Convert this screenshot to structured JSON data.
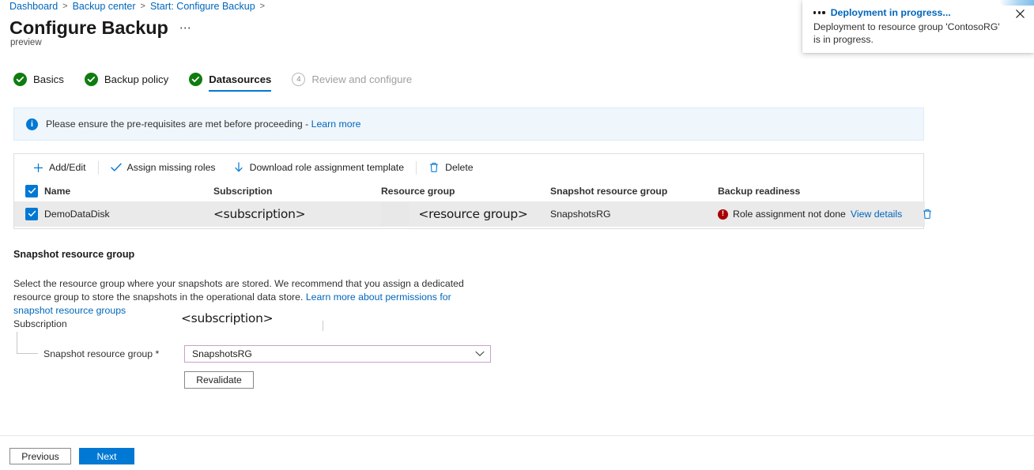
{
  "breadcrumb": {
    "items": [
      "Dashboard",
      "Backup center",
      "Start: Configure Backup"
    ],
    "separator": ">"
  },
  "header": {
    "title": "Configure Backup",
    "ellipsis": "⋯",
    "preview_tag": "preview"
  },
  "steps": [
    {
      "label": "Basics",
      "state": "done",
      "number": "1"
    },
    {
      "label": "Backup policy",
      "state": "done",
      "number": "2"
    },
    {
      "label": "Datasources",
      "state": "active-done",
      "number": "3"
    },
    {
      "label": "Review and configure",
      "state": "pending",
      "number": "4"
    }
  ],
  "info_banner": {
    "icon": "info-icon",
    "text": "Please ensure the pre-requisites are met before proceeding - ",
    "link": "Learn more"
  },
  "toolbar": [
    {
      "label": "Add/Edit",
      "icon": "plus-icon"
    },
    {
      "label": "Assign missing roles",
      "icon": "checkmark-icon"
    },
    {
      "label": "Download role assignment template",
      "icon": "download-arrow-icon"
    },
    {
      "label": "Delete",
      "icon": "trash-icon"
    }
  ],
  "table": {
    "columns": [
      "Name",
      "Subscription",
      "Resource group",
      "Snapshot resource group",
      "Backup readiness"
    ],
    "header_checkbox_checked": true,
    "rows": [
      {
        "checked": true,
        "name": "DemoDataDisk",
        "subscription": "<subscription>",
        "resource_group": "<resource group>",
        "snapshot_resource_group": "SnapshotsRG",
        "readiness_status": "Role assignment not done",
        "readiness_icon": "error-icon",
        "view_details": "View details",
        "delete_icon": "trash-icon"
      }
    ]
  },
  "snapshot_section": {
    "heading": "Snapshot resource group",
    "description": "Select the resource group where your snapshots are stored. We recommend that you assign a dedicated resource group to store the snapshots in the operational data store. ",
    "description_link": "Learn more about permissions for snapshot resource groups",
    "subscription_label": "Subscription",
    "subscription_value": "<subscription>",
    "srg_label": "Snapshot resource group *",
    "srg_value": "SnapshotsRG",
    "srg_chevron": "chevron-down-icon",
    "revalidate_label": "Revalidate"
  },
  "footer": {
    "previous_label": "Previous",
    "next_label": "Next"
  },
  "toast": {
    "title": "Deployment in progress...",
    "body": "Deployment to resource group 'ContosoRG' is in progress.",
    "close_icon": "close-icon",
    "status_icon": "running-dots-icon"
  },
  "colors": {
    "accent": "#0078d4",
    "link": "#0066bb",
    "success": "#107c10",
    "error": "#a80000",
    "focus_border": "#c9a0c9",
    "row_bg": "#eaeaea",
    "banner_bg": "#eff6fc"
  }
}
